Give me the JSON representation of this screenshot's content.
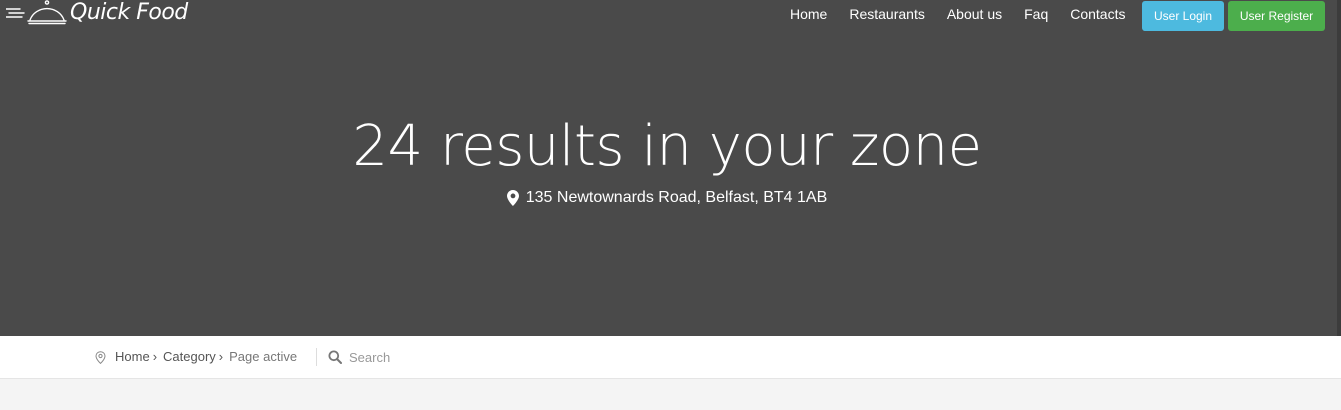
{
  "brand": {
    "name": "Quick Food",
    "logo_icon": "cloche-icon"
  },
  "nav": {
    "items": [
      {
        "label": "Home"
      },
      {
        "label": "Restaurants"
      },
      {
        "label": "About us"
      },
      {
        "label": "Faq"
      },
      {
        "label": "Contacts"
      }
    ],
    "login_label": "User Login",
    "register_label": "User Register"
  },
  "hero": {
    "title": "24 results in your zone",
    "address": "135 Newtownards Road, Belfast, BT4 1AB",
    "address_icon": "map-pin-icon"
  },
  "breadcrumb": {
    "icon": "location-outline-icon",
    "items": [
      {
        "label": "Home"
      },
      {
        "label": "Category"
      },
      {
        "label": "Page active"
      }
    ],
    "separator": "›"
  },
  "search": {
    "placeholder": "Search",
    "icon": "search-icon"
  },
  "colors": {
    "hero_bg": "#4a4a4a",
    "login_btn": "#4dbadf",
    "register_btn": "#4cae4c",
    "page_bg": "#f4f4f4"
  }
}
